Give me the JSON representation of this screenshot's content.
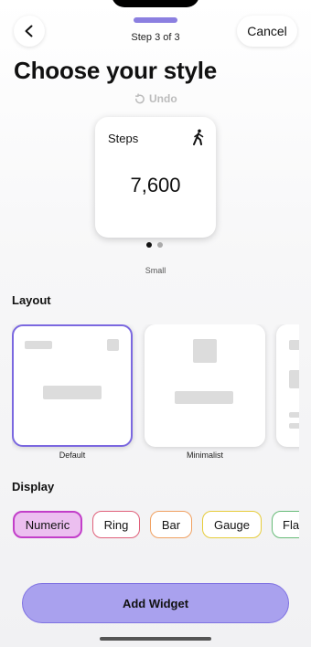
{
  "header": {
    "step_text": "Step 3 of 3",
    "progress": 1.0,
    "cancel_label": "Cancel",
    "back_icon": "chevron-left-icon"
  },
  "title": "Choose your style",
  "undo_label": "Undo",
  "preview": {
    "label": "Steps",
    "value": "7,600",
    "icon": "walking-person-icon",
    "size_label": "Small",
    "pages": 2,
    "active_page": 1
  },
  "layout": {
    "section_title": "Layout",
    "options": [
      {
        "label": "Default",
        "selected": true
      },
      {
        "label": "Minimalist",
        "selected": false
      },
      {
        "label": "",
        "selected": false
      }
    ]
  },
  "display": {
    "section_title": "Display",
    "options": [
      {
        "label": "Numeric",
        "color": "#c23ec9",
        "fill": "#ecbff0",
        "selected": true
      },
      {
        "label": "Ring",
        "color": "#e0607a",
        "selected": false
      },
      {
        "label": "Bar",
        "color": "#f0a060",
        "selected": false
      },
      {
        "label": "Gauge",
        "color": "#e6cc3a",
        "selected": false
      },
      {
        "label": "Fla",
        "color": "#66bb77",
        "selected": false
      }
    ]
  },
  "footer": {
    "add_label": "Add Widget"
  },
  "colors": {
    "accent": "#7b68e0",
    "button_fill": "#a9a1ee"
  }
}
